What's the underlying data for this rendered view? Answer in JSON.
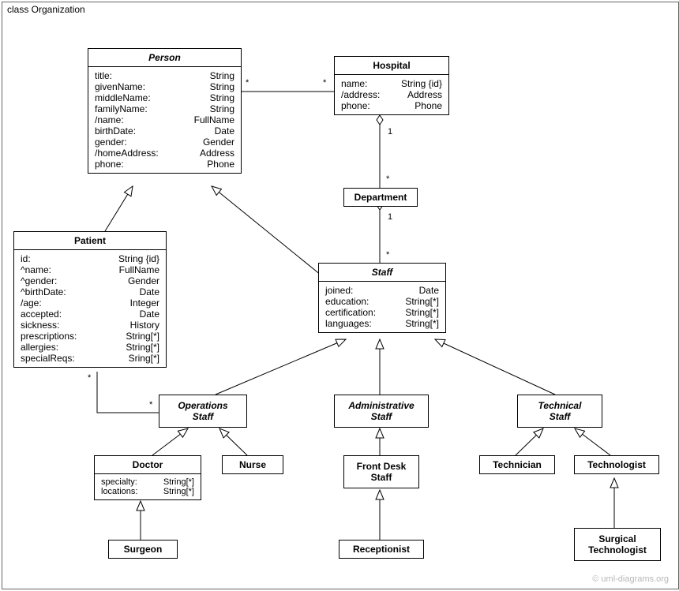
{
  "frame_label": "class Organization",
  "copyright": "© uml-diagrams.org",
  "classes": {
    "person": {
      "name": "Person",
      "attrs": [
        {
          "n": "title:",
          "t": "String"
        },
        {
          "n": "givenName:",
          "t": "String"
        },
        {
          "n": "middleName:",
          "t": "String"
        },
        {
          "n": "familyName:",
          "t": "String"
        },
        {
          "n": "/name:",
          "t": "FullName"
        },
        {
          "n": "birthDate:",
          "t": "Date"
        },
        {
          "n": "gender:",
          "t": "Gender"
        },
        {
          "n": "/homeAddress:",
          "t": "Address"
        },
        {
          "n": "phone:",
          "t": "Phone"
        }
      ]
    },
    "hospital": {
      "name": "Hospital",
      "attrs": [
        {
          "n": "name:",
          "t": "String {id}"
        },
        {
          "n": "/address:",
          "t": "Address"
        },
        {
          "n": "phone:",
          "t": "Phone"
        }
      ]
    },
    "department": {
      "name": "Department"
    },
    "patient": {
      "name": "Patient",
      "attrs": [
        {
          "n": "id:",
          "t": "String {id}"
        },
        {
          "n": "^name:",
          "t": "FullName"
        },
        {
          "n": "^gender:",
          "t": "Gender"
        },
        {
          "n": "^birthDate:",
          "t": "Date"
        },
        {
          "n": "/age:",
          "t": "Integer"
        },
        {
          "n": "accepted:",
          "t": "Date"
        },
        {
          "n": "sickness:",
          "t": "History"
        },
        {
          "n": "prescriptions:",
          "t": "String[*]"
        },
        {
          "n": "allergies:",
          "t": "String[*]"
        },
        {
          "n": "specialReqs:",
          "t": "Sring[*]"
        }
      ]
    },
    "staff": {
      "name": "Staff",
      "attrs": [
        {
          "n": "joined:",
          "t": "Date"
        },
        {
          "n": "education:",
          "t": "String[*]"
        },
        {
          "n": "certification:",
          "t": "String[*]"
        },
        {
          "n": "languages:",
          "t": "String[*]"
        }
      ]
    },
    "opsStaff": {
      "name": "Operations",
      "sub": "Staff"
    },
    "adminStaff": {
      "name": "Administrative",
      "sub": "Staff"
    },
    "techStaff": {
      "name": "Technical",
      "sub": "Staff"
    },
    "doctor": {
      "name": "Doctor",
      "attrs": [
        {
          "n": "specialty:",
          "t": "String[*]"
        },
        {
          "n": "locations:",
          "t": "String[*]"
        }
      ]
    },
    "nurse": {
      "name": "Nurse"
    },
    "frontDesk": {
      "name": "Front Desk",
      "sub": "Staff"
    },
    "receptionist": {
      "name": "Receptionist"
    },
    "technician": {
      "name": "Technician"
    },
    "technologist": {
      "name": "Technologist"
    },
    "surgTech": {
      "name": "Surgical",
      "sub": "Technologist"
    },
    "surgeon": {
      "name": "Surgeon"
    }
  },
  "mult": {
    "ph1": "*",
    "ph2": "*",
    "hd1": "1",
    "hd2": "*",
    "ds1": "1",
    "ds2": "*",
    "po1": "*",
    "po2": "*"
  }
}
